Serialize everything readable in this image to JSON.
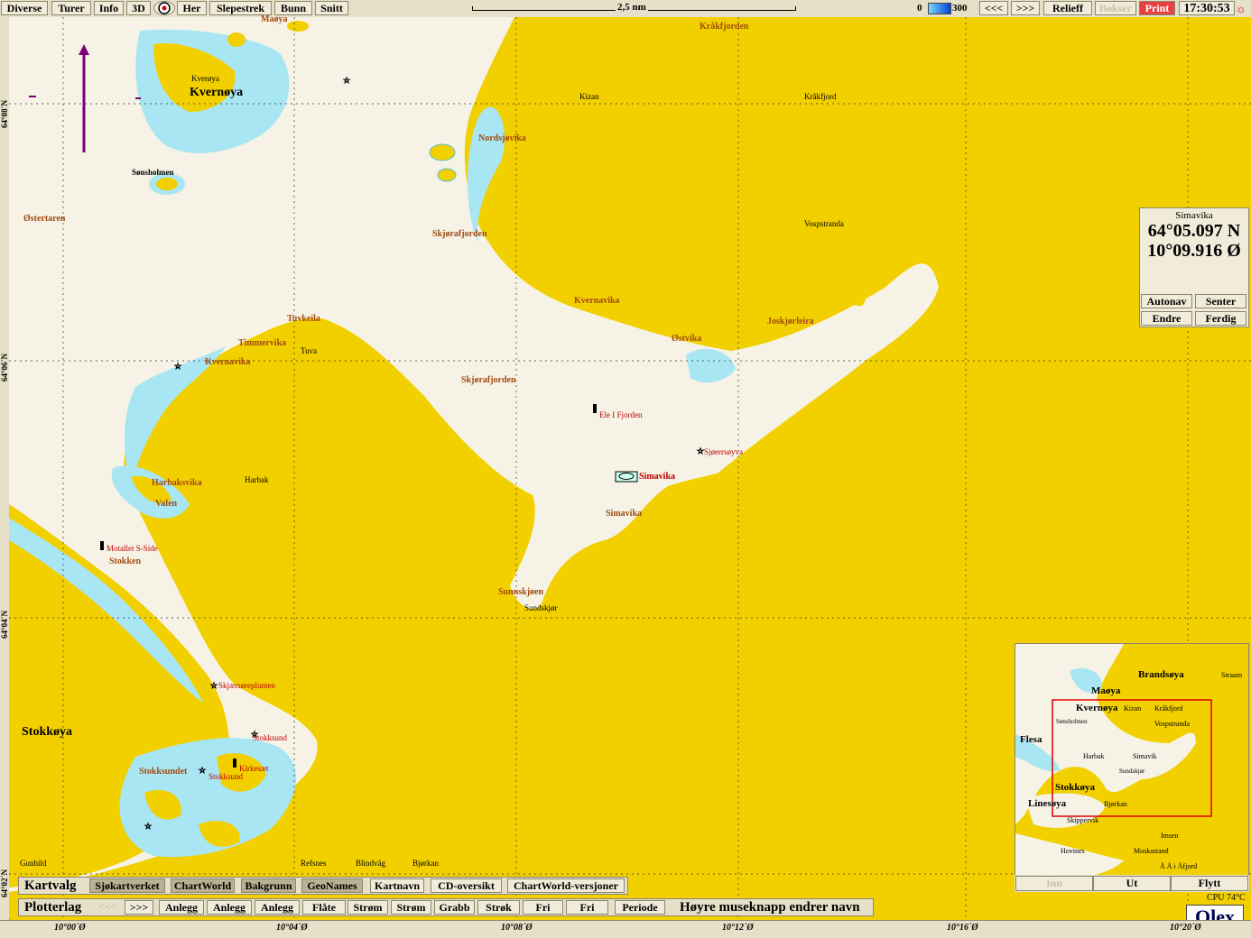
{
  "topmenu": {
    "items": [
      "Diverse",
      "Turer",
      "Info",
      "3D",
      "Her",
      "Slepestrek",
      "Bunn",
      "Snitt"
    ],
    "scale_label": "2,5 nm",
    "depth_min": "0",
    "depth_max": "300",
    "prev": "<<<",
    "next": ">>>",
    "relief": "Relieff",
    "bokser": "Bokser",
    "print": "Print",
    "clock": "17:30:53"
  },
  "position_panel": {
    "name": "Simavika",
    "lat": "64°05.097 N",
    "lon": "10°09.916 Ø",
    "buttons": [
      "Autonav",
      "Senter",
      "Endre",
      "Ferdig"
    ]
  },
  "grid": {
    "lon_labels": [
      "10°00´Ø",
      "10°04´Ø",
      "10°08´Ø",
      "10°12´Ø",
      "10°16´Ø",
      "10°20´Ø"
    ],
    "lat_labels": [
      "64°08´N",
      "64°06´N",
      "64°04´N",
      "64°02´N"
    ]
  },
  "places": [
    {
      "n": "Kverøya",
      "cls": "black"
    },
    {
      "n": "Kvernøya",
      "cls": "big"
    },
    {
      "n": "Maøya",
      "cls": ""
    },
    {
      "n": "Sønsholmen",
      "cls": "black"
    },
    {
      "n": "Østertaren",
      "cls": ""
    },
    {
      "n": "Kråkfjorden",
      "cls": ""
    },
    {
      "n": "Kizan",
      "cls": "black"
    },
    {
      "n": "Kråkfjord",
      "cls": "black"
    },
    {
      "n": "Nordsjøvika",
      "cls": ""
    },
    {
      "n": "Skjørafjorden",
      "cls": ""
    },
    {
      "n": "Vospstranda",
      "cls": "black"
    },
    {
      "n": "Kvernavika",
      "cls": ""
    },
    {
      "n": "Joskjørleira",
      "cls": ""
    },
    {
      "n": "Østvika",
      "cls": ""
    },
    {
      "n": "Tuvkeila",
      "cls": ""
    },
    {
      "n": "Tuva",
      "cls": "black"
    },
    {
      "n": "Timmervika",
      "cls": ""
    },
    {
      "n": "Kvernavika",
      "cls": ""
    },
    {
      "n": "Skjørafjorden",
      "cls": ""
    },
    {
      "n": "Harbak",
      "cls": "black"
    },
    {
      "n": "Harbaksvika",
      "cls": ""
    },
    {
      "n": "Valen",
      "cls": ""
    },
    {
      "n": "Simavika",
      "cls": ""
    },
    {
      "n": "Simavika",
      "cls": ""
    },
    {
      "n": "Stokken",
      "cls": ""
    },
    {
      "n": "Sunnskjøen",
      "cls": ""
    },
    {
      "n": "Sundskjør",
      "cls": "black"
    },
    {
      "n": "Stokkøya",
      "cls": "big"
    },
    {
      "n": "Stokksundet",
      "cls": ""
    },
    {
      "n": "Refsnes",
      "cls": "black"
    },
    {
      "n": "Blindvåg",
      "cls": "black"
    },
    {
      "n": "Bjørkan",
      "cls": "black"
    },
    {
      "n": "Gunhild",
      "cls": "black"
    }
  ],
  "positions": [
    "Ele I Fjorden",
    "Motallet S-Side",
    "Skjærsøreplunten",
    "Stokksund",
    "Kirkesæt",
    "Stokksund",
    "Sjøerrsøyva"
  ],
  "simavika_marker": "Simavika",
  "minimap": {
    "labels": [
      "Brandsøya",
      "Maøya",
      "Kvernøya",
      "Kizan",
      "Kråkfjord",
      "Vospstranda",
      "Flesa",
      "Harbak",
      "Simavik",
      "Stokkøya",
      "Linesøya",
      "Bjørkan",
      "Skippervik",
      "Imsen",
      "Hovines",
      "Moskastand",
      "Å Å i Åfjord",
      "Straum",
      "Sønsholmen",
      "Sundskjør"
    ],
    "buttons": [
      "Inn",
      "Ut",
      "Flytt"
    ]
  },
  "cpu": "CPU 74°C",
  "brand": "Olex",
  "kartvalg": {
    "title": "Kartvalg",
    "buttons": [
      {
        "label": "Sjøkartverket",
        "on": true
      },
      {
        "label": "ChartWorld",
        "on": true
      },
      {
        "label": "Bakgrunn",
        "on": true
      },
      {
        "label": "GeoNames",
        "on": true
      },
      {
        "label": "Kartnavn",
        "on": false
      },
      {
        "label": "CD-oversikt",
        "on": false
      },
      {
        "label": "ChartWorld-versjoner",
        "on": false
      }
    ]
  },
  "plotterlag": {
    "title": "Plotterlag",
    "prev": "<<<",
    "next": ">>>",
    "buttons": [
      "Anlegg",
      "Anlegg",
      "Anlegg",
      "Flåte",
      "Strøm",
      "Strøm",
      "Grabb",
      "Strøk",
      "Fri",
      "Fri",
      "Periode"
    ],
    "note": "Høyre museknapp endrer navn"
  }
}
